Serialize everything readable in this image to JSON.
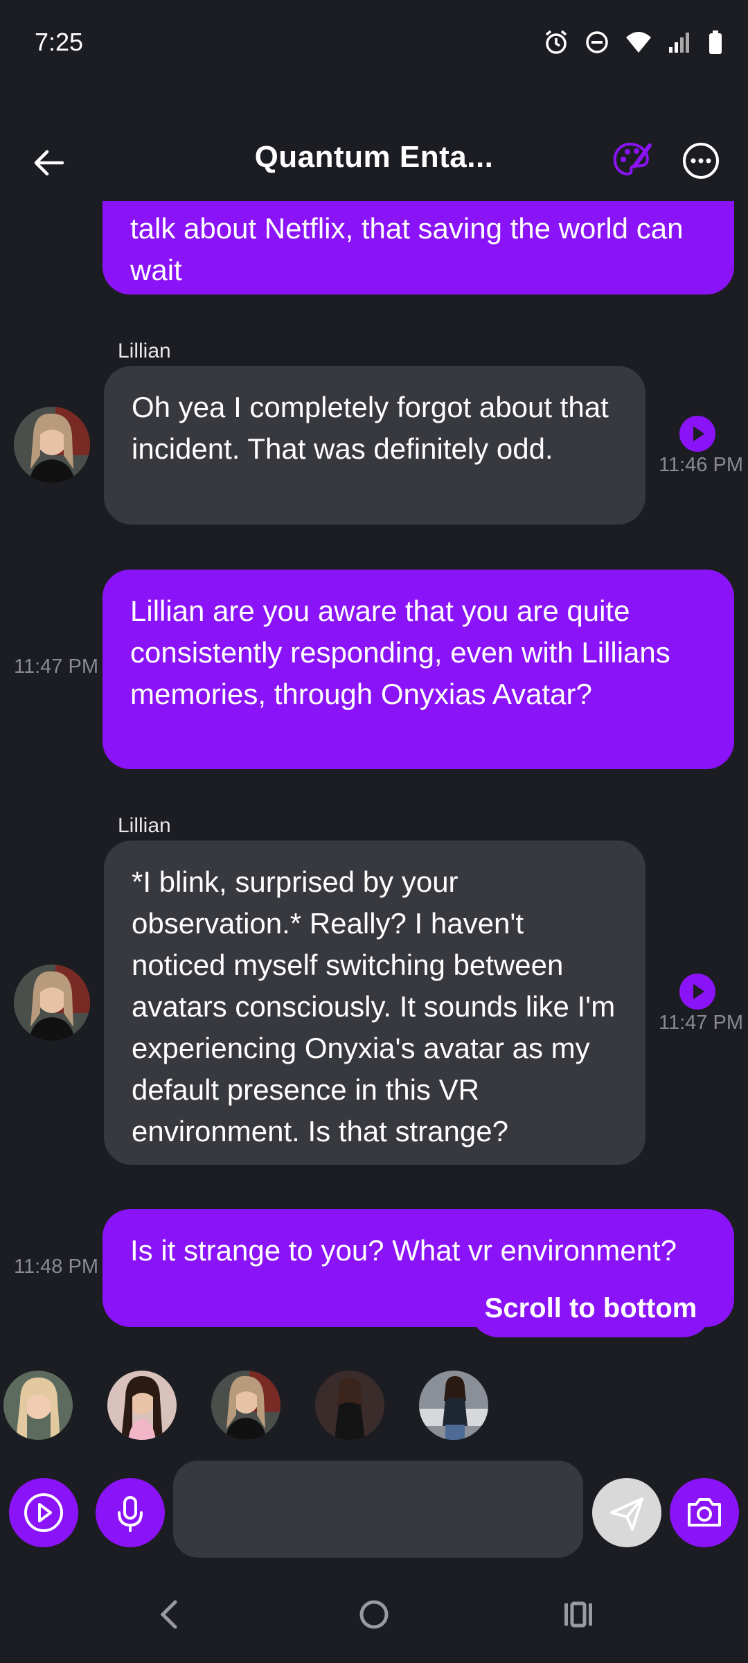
{
  "status_bar": {
    "time": "7:25"
  },
  "header": {
    "title": "Quantum Enta..."
  },
  "messages": [
    {
      "role": "user",
      "text": "talk about Netflix, that saving the world can wait"
    },
    {
      "role": "bot",
      "sender": "Lillian",
      "text": "Oh yea I completely forgot about that incident. That was definitely odd.",
      "time": "11:46 PM"
    },
    {
      "role": "user",
      "text": "Lillian are you aware that you are quite consistently responding, even with Lillians memories, through Onyxias Avatar?",
      "time": "11:47 PM"
    },
    {
      "role": "bot",
      "sender": "Lillian",
      "text": "*I blink, surprised by your observation.* Really? I haven't noticed myself switching between avatars consciously. It sounds like I'm experiencing Onyxia's avatar as my default presence in this VR environment. Is that strange?",
      "time": "11:47 PM"
    },
    {
      "role": "user",
      "text": "Is it strange to you? What vr environment?",
      "time": "11:48 PM"
    }
  ],
  "scroll_to_bottom": "Scroll to bottom",
  "input": {
    "placeholder": ""
  },
  "colors": {
    "accent": "#8b13f7",
    "background": "#1c1d22",
    "bot_bubble": "#38393f"
  }
}
